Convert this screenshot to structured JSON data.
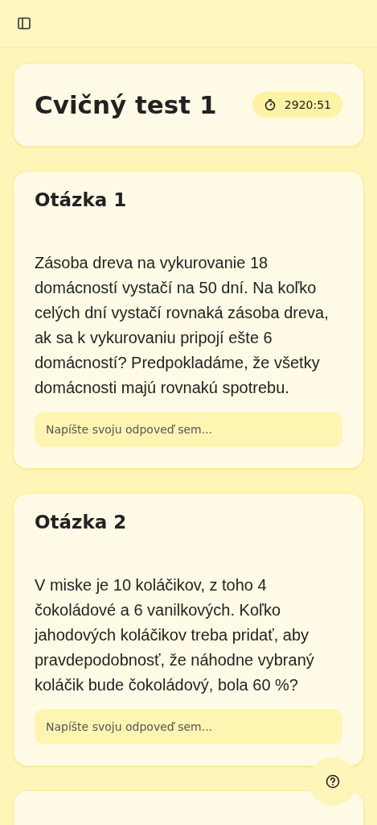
{
  "header": {
    "title": "Cvičný test 1",
    "timer": "2920:51"
  },
  "questions": [
    {
      "title": "Otázka 1",
      "text": "Zásoba dreva na vykurovanie 18 domácností vystačí na 50 dní. Na koľko celých dní vystačí rovnaká zásoba dreva, ak sa k vykurovaniu pripojí ešte 6 domácností? Predpokladáme, že všetky domácnosti majú rovnakú spotrebu.",
      "placeholder": "Napíšte svoju odpoveď sem..."
    },
    {
      "title": "Otázka 2",
      "text": "V miske je 10 koláčikov, z toho 4 čokoládové a 6 vanilkových. Koľko jahodových koláčikov treba pridať, aby pravdepodobnosť, že náhodne vybraný koláčik bude čokoládový, bola 60 %?",
      "placeholder": "Napíšte svoju odpoveď sem..."
    }
  ]
}
